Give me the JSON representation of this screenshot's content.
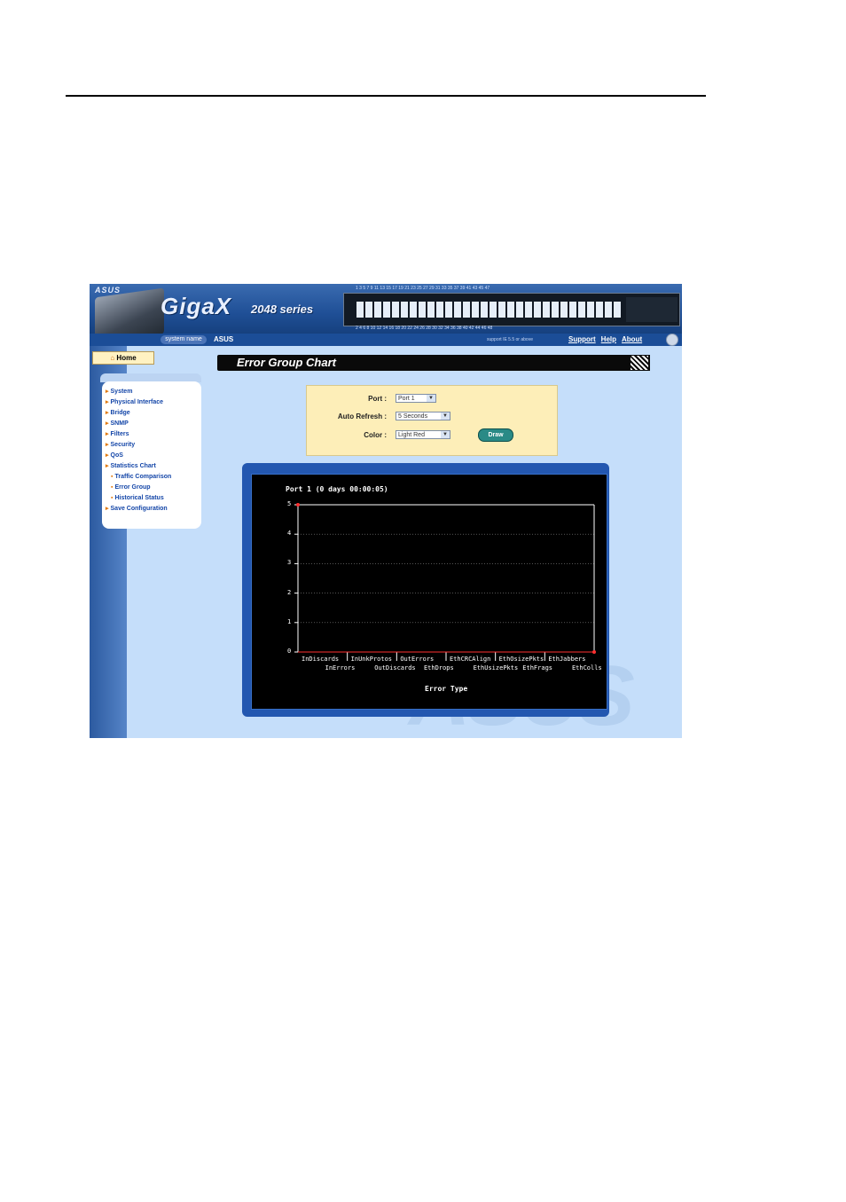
{
  "header": {
    "logo": "ASUS",
    "brand": "GigaX",
    "series": "2048 series",
    "system_name_label": "system name",
    "system_name_value": "ASUS",
    "support_note": "support IE 5.5 or above",
    "links": [
      "Support",
      "Help",
      "About"
    ],
    "port_numbers_top": "1 3 5 7 9 11 13 15 17 19 21 23 25 27 29 31 33 35 37 39 41 43 45 47",
    "port_numbers_bottom": "2 4 6 8 10 12 14 16 18 20 22 24 26 28 30 32 34 36 38 40 42 44 46 48"
  },
  "nav": {
    "home": "Home",
    "items": [
      {
        "label": "System",
        "level": 0
      },
      {
        "label": "Physical Interface",
        "level": 0
      },
      {
        "label": "Bridge",
        "level": 0
      },
      {
        "label": "SNMP",
        "level": 0
      },
      {
        "label": "Filters",
        "level": 0
      },
      {
        "label": "Security",
        "level": 0
      },
      {
        "label": "QoS",
        "level": 0
      },
      {
        "label": "Statistics Chart",
        "level": 0
      },
      {
        "label": "Traffic Comparison",
        "level": 1
      },
      {
        "label": "Error Group",
        "level": 1
      },
      {
        "label": "Historical Status",
        "level": 1
      },
      {
        "label": "Save Configuration",
        "level": 0
      }
    ]
  },
  "page": {
    "title": "Error Group Chart"
  },
  "form": {
    "port_label": "Port :",
    "port_value": "Port 1",
    "refresh_label": "Auto Refresh :",
    "refresh_value": "5 Seconds",
    "color_label": "Color :",
    "color_value": "Light Red",
    "draw_label": "Draw"
  },
  "chart_data": {
    "type": "line",
    "title": "Port 1 (0 days 00:00:05)",
    "xlabel": "Error Type",
    "ylabel": "",
    "ylim": [
      0,
      5
    ],
    "yticks": [
      "0",
      "1",
      "2",
      "3",
      "4",
      "5"
    ],
    "categories_top": [
      "InDiscards",
      "InUnkProtos",
      "OutErrors",
      "EthCRCAlign",
      "EthOsizePkts",
      "EthJabbers"
    ],
    "categories_bottom": [
      "InErrors",
      "OutDiscards",
      "EthDrops",
      "EthUsizePkts",
      "EthFrags",
      "EthColls"
    ],
    "series": [
      {
        "values": [
          0,
          0,
          0,
          0,
          0,
          0,
          0,
          0,
          0,
          0,
          0,
          0
        ],
        "color": "#ff3030"
      }
    ],
    "grid": true,
    "colors": {
      "background": "#000000",
      "axis": "#ffffff",
      "grid": "#888888"
    }
  },
  "watermark": "ASUS"
}
